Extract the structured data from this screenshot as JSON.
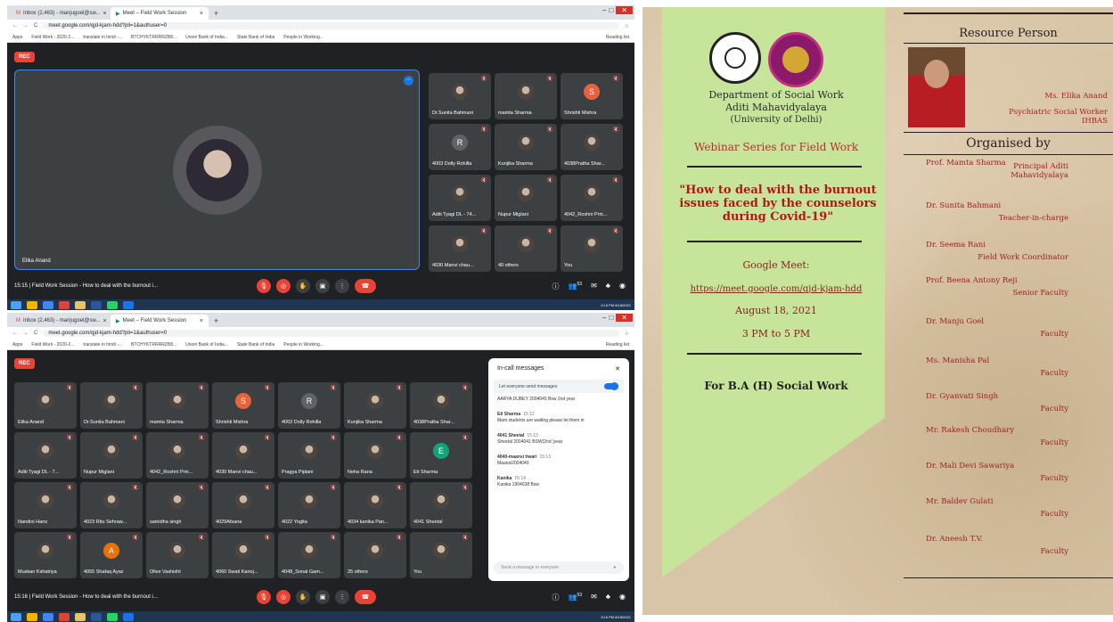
{
  "browser": {
    "tab1": "Inbox (2,463) - manjugoel@sw...",
    "tab2": "Meet – Field Work Session",
    "url": "meet.google.com/qjd-kjam-hdd?pli=1&authuser=0",
    "bookmarks": [
      "Apps",
      "Field Work - 2020-2...",
      "translate in hindi -...",
      "BTCHYKTRRRRZB8...",
      "Union Bank of India...",
      "State Bank of India",
      "People in Working..."
    ],
    "reading_list": "Reading list"
  },
  "meet1": {
    "rec": "REC",
    "main_name": "Elika Anand",
    "bottom_text": "15:15  |  Field Work Session - How to deal with the burnout i...",
    "participants": [
      "Dr.Sunita Bahmani",
      "mamta Sharma",
      "Shrishti Mishra",
      "4003 Dolly Rohilla",
      "Kunjika Sharma",
      "4038Pratha Shar...",
      "Aditi Tyagi DL - 74...",
      "Nupur Miglani",
      "4042_Roshni Prin...",
      "4030 Manvi chau...",
      "40 others",
      "You"
    ],
    "people_count": "53",
    "clock": "3:15 PM 8/18/2021"
  },
  "meet2": {
    "rec": "REC",
    "bottom_text": "15:16  |  Field Work Session - How to deal with the burnout i...",
    "participants": [
      "Elika Anand",
      "Dr.Sunita Bahmani",
      "mamta Sharma",
      "Shrishti Mishra",
      "4003 Dolly Rohilla",
      "Kunjika Sharma",
      "4038Pratha Shar...",
      "Aditi Tyagi DL - 7...",
      "Nupur Miglani",
      "4042_Roshni Prin...",
      "4030 Manvi chau...",
      "Pragya Piplani",
      "Neha Rana",
      "Eti Sharma",
      "Nandini Hans",
      "4023 Ritu Sehraw...",
      "samidha singh",
      "4029Afsana",
      "4022 Yogita",
      "4034 kanika Pan...",
      "4041 Sheetal",
      "Muskan Kshatriya",
      "4055 Shafaq Ayaz",
      "Olive Vashisht",
      "4060 Swati Kanoj...",
      "4048_Sonal Gam...",
      "25 others",
      "You"
    ],
    "people_count": "53",
    "clock": "3:16 PM 8/18/2021",
    "chat": {
      "title": "In-call messages",
      "allow": "Let everyone send messages",
      "messages": [
        {
          "head": "",
          "time": "",
          "text": "AARYA DUBEY 2004045 Bsw 2nd year"
        },
        {
          "head": "Eti Sharma",
          "time": "15:12",
          "text": "Mam students are waiting please let them in"
        },
        {
          "head": "4041 Sheetal",
          "time": "15:13",
          "text": "Sheetal 2004041 BSW(2nd )year"
        },
        {
          "head": "4040-maansi tiwari",
          "time": "15:13",
          "text": "Maansi2004040"
        },
        {
          "head": "Kanika",
          "time": "15:14",
          "text": "Kanika 1904038 Bsw"
        }
      ],
      "input_placeholder": "Send a message to everyone"
    }
  },
  "poster": {
    "dept": "Department of Social Work",
    "college": "Aditi Mahavidyalaya",
    "university": "(University of Delhi)",
    "series": "Webinar Series for Field Work",
    "title": "\"How to deal with the burnout issues faced by the counselors during Covid-19\"",
    "meet_label": "Google Meet:",
    "link": "https://meet.google.com/qjd-kjam-hdd",
    "date": "August 18, 2021",
    "time": "3 PM to 5 PM",
    "for": "For B.A (H) Social Work",
    "rp_heading": "Resource Person",
    "rp_name": "Ms. Elika Anand",
    "rp_role1": "Psychiatric Social Worker",
    "rp_role2": "IHBAS",
    "org_heading": "Organised by",
    "organisers": [
      {
        "name": "Prof. Mamta Sharma",
        "role": "Principal Aditi Mahavidyalaya"
      },
      {
        "name": "Dr. Sunita Bahmani",
        "role": "Teacher-in-charge"
      },
      {
        "name": "Dr. Seema Rani",
        "role": "Field Work Coordinator"
      },
      {
        "name": "Prof. Beena Antony Reji",
        "role": "Senior Faculty"
      },
      {
        "name": "Dr. Manju Goel",
        "role": "Faculty"
      },
      {
        "name": "Ms. Manisha Pal",
        "role": "Faculty"
      },
      {
        "name": "Dr. Gyanvati Singh",
        "role": "Faculty"
      },
      {
        "name": "Mr. Rakesh Choudhary",
        "role": "Faculty"
      },
      {
        "name": "Dr. Mali Devi Sawariya",
        "role": "Faculty"
      },
      {
        "name": "Mr. Baldev Gulati",
        "role": "Faculty"
      },
      {
        "name": "Dr. Aneesh T.V.",
        "role": "Faculty"
      }
    ]
  }
}
